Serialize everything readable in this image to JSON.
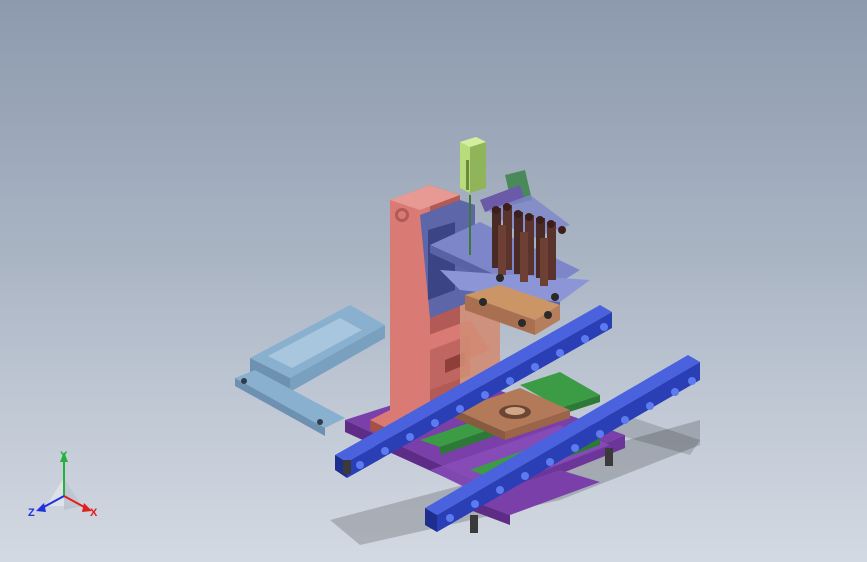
{
  "scene": {
    "background_top": "#8d9aae",
    "background_bottom": "#d3d9e2",
    "colors": {
      "column": "#d97b74",
      "column_dark": "#b25a55",
      "blue_rail": "#2a3fb6",
      "blue_rail_light": "#4a62dd",
      "blue_bolt": "#5d7bf0",
      "light_blue_table": "#8ab0cf",
      "purple_base": "#7a3fa8",
      "green_rail": "#3c9c46",
      "orange_plate": "#cc9566",
      "motor_green": "#b9dc7a",
      "tool_dark": "#4a2a24",
      "bracket_blue": "#7d86c9"
    }
  },
  "triad": {
    "x_label": "X",
    "y_label": "Y",
    "z_label": "Z",
    "x_color": "#e0201c",
    "y_color": "#26b03a",
    "z_color": "#2030e0"
  }
}
